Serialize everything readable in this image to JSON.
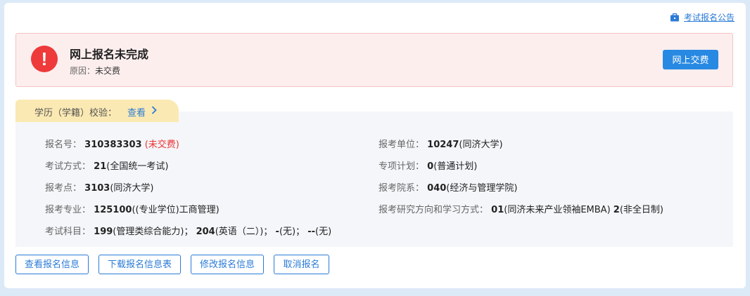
{
  "header": {
    "notice_link": "考试报名公告"
  },
  "alert": {
    "title": "网上报名未完成",
    "reason_label": "原因：",
    "reason_value": "未交费",
    "pay_button": "网上交费",
    "icon_glyph": "!",
    "color": "#ee3a3a"
  },
  "tab": {
    "label": "学历（学籍）校验：",
    "link": "查看"
  },
  "info": {
    "reg_no": {
      "label": "报名号：",
      "value": "310383303",
      "status": "(未交费)"
    },
    "unit": {
      "label": "报考单位：",
      "code": "10247",
      "name": "(同济大学)"
    },
    "exam_mode": {
      "label": "考试方式：",
      "code": "21",
      "name": "(全国统一考试)"
    },
    "special_plan": {
      "label": "专项计划：",
      "code": "0",
      "name": "(普通计划)"
    },
    "exam_site": {
      "label": "报考点：",
      "code": "3103",
      "name": "(同济大学)"
    },
    "department": {
      "label": "报考院系：",
      "code": "040",
      "name": "(经济与管理学院)"
    },
    "major": {
      "label": "报考专业：",
      "code": "125100",
      "name": "((专业学位)工商管理)"
    },
    "direction": {
      "label": "报考研究方向和学习方式：",
      "code": "01",
      "name": "(同济未来产业领袖EMBA)",
      "mode_code": "2",
      "mode_name": "(非全日制)"
    },
    "subjects": {
      "label": "考试科目：",
      "items": [
        {
          "code": "199",
          "name": "(管理类综合能力)；"
        },
        {
          "code": "204",
          "name": "(英语（二）)；"
        },
        {
          "code": "-",
          "name": "(无)；"
        },
        {
          "code": "--",
          "name": "(无)"
        }
      ]
    }
  },
  "actions": {
    "view": "查看报名信息",
    "download": "下载报名信息表",
    "edit": "修改报名信息",
    "cancel": "取消报名"
  },
  "colors": {
    "accent": "#2b7bd6",
    "tab_bg": "#fbe9b3",
    "alert_bg": "#fdeeee"
  }
}
